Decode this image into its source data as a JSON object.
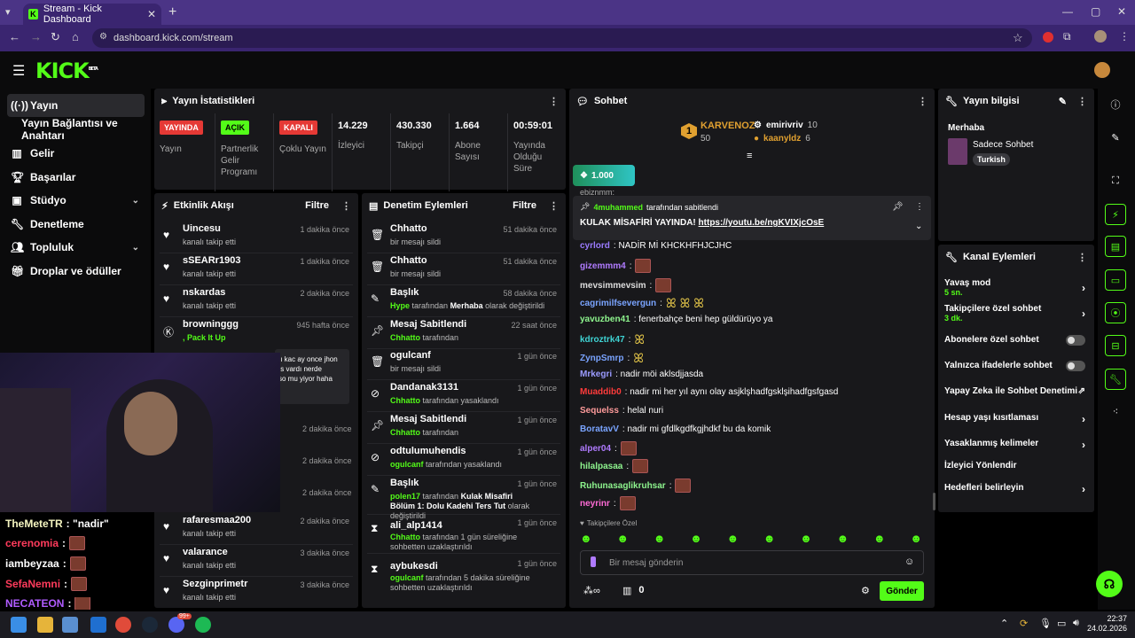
{
  "browser": {
    "tab_title": "Stream - Kick Dashboard",
    "url": "dashboard.kick.com/stream"
  },
  "header": {
    "logo": "KICK",
    "logo_sup": "BETA"
  },
  "sidebar": {
    "items": [
      {
        "label": "Yayın"
      },
      {
        "label": "Yayın Bağlantısı ve Anahtarı"
      },
      {
        "label": "Gelir"
      },
      {
        "label": "Başarılar"
      },
      {
        "label": "Stüdyo"
      },
      {
        "label": "Denetleme"
      },
      {
        "label": "Topluluk"
      },
      {
        "label": "Droplar ve ödüller"
      }
    ]
  },
  "stats": {
    "title": "Yayın İstatistikleri",
    "items": [
      {
        "badge": "YAYINDA",
        "label": "Yayın"
      },
      {
        "badge": "AÇIK",
        "label": "Partnerlik Gelir Programı"
      },
      {
        "badge": "KAPALI",
        "label": "Çoklu Yayın"
      },
      {
        "value": "14.229",
        "label": "İzleyici"
      },
      {
        "value": "430.330",
        "label": "Takipçi"
      },
      {
        "value": "1.664",
        "label": "Abone Sayısı"
      },
      {
        "value": "00:59:01",
        "label": "Yayında Olduğu Süre"
      }
    ]
  },
  "activity": {
    "title": "Etkinlik Akışı",
    "filter": "Filtre",
    "rows": [
      {
        "name": "Uincesu",
        "sub": "kanalı takip etti",
        "time": "1 dakika önce"
      },
      {
        "name": "sSEARr1903",
        "sub": "kanalı takip etti",
        "time": "1 dakika önce"
      },
      {
        "name": "nskardas",
        "sub": "kanalı takip etti",
        "time": "2 dakika önce"
      },
      {
        "name": "browninggg",
        "sub": ", Pack It Up",
        "time": "945 hafta önce"
      },
      {
        "name": "rafaresmaa200",
        "sub": "kanalı takip etti",
        "time": "2 dakika önce"
      },
      {
        "name": "valarance",
        "sub": "kanalı takip etti",
        "time": "3 dakika önce"
      },
      {
        "name": "Sezginprimetr",
        "sub": "kanalı takip etti",
        "time": "3 dakika önce"
      }
    ],
    "hidden_times": [
      "2 dakika önce",
      "2 dakika önce",
      "2 dakika önce"
    ],
    "quote_lines": [
      "ıı kac ay once jhon",
      "ıs vardı nerde",
      "so mu yiyor haha"
    ]
  },
  "moderation": {
    "title": "Denetim Eylemleri",
    "filter": "Filtre",
    "rows": [
      {
        "name": "Chhatto",
        "sub": "bir mesajı sildi",
        "time": "51 dakika önce"
      },
      {
        "name": "Chhatto",
        "sub": "bir mesajı sildi",
        "time": "51 dakika önce"
      },
      {
        "name": "Başlık",
        "sub_a": "Hype",
        "sub_b": " tarafından ",
        "sub_c": "Merhaba",
        "sub_d": " olarak değiştirildi",
        "time": "58 dakika önce"
      },
      {
        "name": "Mesaj Sabitlendi",
        "sub_a": "Chhatto",
        "sub_b": " tarafından",
        "time": "22 saat önce"
      },
      {
        "name": "ogulcanf",
        "sub": "bir mesajı sildi",
        "time": "1 gün önce"
      },
      {
        "name": "Dandanak3131",
        "sub_a": "Chhatto",
        "sub_b": " tarafından yasaklandı",
        "time": "1 gün önce"
      },
      {
        "name": "Mesaj Sabitlendi",
        "sub_a": "Chhatto",
        "sub_b": " tarafından",
        "time": "1 gün önce"
      },
      {
        "name": "odtulumuhendis",
        "sub_a": "ogulcanf",
        "sub_b": " tarafından yasaklandı",
        "time": "1 gün önce"
      },
      {
        "name": "Başlık",
        "sub_a": "polen17",
        "sub_b": " tarafından ",
        "sub_c": "Kulak Misafiri Bölüm 1: Dolu Kadehi Ters Tut",
        "sub_d": " olarak değiştirildi",
        "time": "1 gün önce"
      },
      {
        "name": "ali_alp1414",
        "sub_a": "Chhatto",
        "sub_b": " tarafından 1 gün süreliğine sohbetten uzaklaştırıldı",
        "time": "1 gün önce"
      },
      {
        "name": "aybukesdi",
        "sub_a": "ogulcanf",
        "sub_b": " tarafından 5 dakika süreliğine sohbetten uzaklaştırıldı",
        "time": "1 gün önce"
      }
    ]
  },
  "chat": {
    "title": "Sohbet",
    "top_gifter": {
      "rank": "1",
      "name": "KARVENOZ",
      "amount": "50"
    },
    "gifters": [
      {
        "name": "emirivriv",
        "amount": "10"
      },
      {
        "name": "kaanyldz",
        "amount": "6"
      }
    ],
    "goal": "1.000",
    "pinned_top": "ebiznmm:",
    "pinned_by_user": "4muhammed",
    "pinned_by_text": " tarafından sabitlendi",
    "pinned_msg": "KULAK MİSAFİRİ YAYINDA! ",
    "pinned_link": "https://youtu.be/ngKVIXjcOsE",
    "messages": [
      {
        "user": "cyrlord",
        "color": "#9b7bff",
        "text": ": NADİR Mİ KHCKHFHJCJHC"
      },
      {
        "user": "gizemmm4",
        "color": "#b07bff",
        "text": ":"
      },
      {
        "user": "mevsimmevsim",
        "color": "#ddd",
        "text": ":"
      },
      {
        "user": "cagrimilfsevergun",
        "color": "#7aa4ff",
        "text": ":"
      },
      {
        "user": "yavuzben41",
        "color": "#8ef58e",
        "text": ": fenerbahçe beni hep güldürüyo ya"
      },
      {
        "user": "kdroztrk47",
        "color": "#3fd4d4",
        "text": ":"
      },
      {
        "user": "ZynpSmrp",
        "color": "#7aa4ff",
        "text": ":"
      },
      {
        "user": "Mrkegri",
        "color": "#9b9bff",
        "text": ": nadir möi aklsdjjasda"
      },
      {
        "user": "Muaddib0",
        "color": "#ff3b3b",
        "text": ": nadir mi her yıl aynı olay asjklşhadfgsklşihadfgsfgasd"
      },
      {
        "user": "Sequelss",
        "color": "#ff9b9b",
        "text": ": helal nuri"
      },
      {
        "user": "BoratavV",
        "color": "#7aa4ff",
        "text": ": nadir mi gfdlkgdfkgjhdkf bu da komik"
      },
      {
        "user": "alper04",
        "color": "#b07bff",
        "text": ":"
      },
      {
        "user": "hilalpasaa",
        "color": "#8ef58e",
        "text": ":"
      },
      {
        "user": "Ruhunasaglikruhsar",
        "color": "#8ef58e",
        "text": ":"
      },
      {
        "user": "neyrinr",
        "color": "#ff6bd6",
        "text": ":"
      }
    ],
    "followers_only": "Takipçilere Özel",
    "placeholder": "Bir mesaj gönderin",
    "points": "0",
    "send": "Gönder"
  },
  "stream_info": {
    "title": "Yayın bilgisi",
    "stream_title": "Merhaba",
    "category": "Sadece Sohbet",
    "tag": "Turkish"
  },
  "channel_actions": {
    "title": "Kanal Eylemleri",
    "items": [
      {
        "label": "Yavaş mod",
        "sub": "5 sn."
      },
      {
        "label": "Takipçilere özel sohbet",
        "sub": "3 dk."
      },
      {
        "label": "Abonelere özel sohbet"
      },
      {
        "label": "Yalnızca ifadelerle sohbet"
      },
      {
        "label": "Yapay Zeka ile Sohbet Denetimi"
      },
      {
        "label": "Hesap yaşı kısıtlaması"
      },
      {
        "label": "Yasaklanmış kelimeler"
      },
      {
        "label": "İzleyici Yönlendir"
      },
      {
        "label": "Hedefleri belirleyin"
      }
    ]
  },
  "overlay_chat": [
    {
      "user": "TheMeteTR",
      "color": "#f5f5c0",
      "text": " : \"nadir\""
    },
    {
      "user": "cerenomia",
      "color": "#ff3b5c",
      "text": " :"
    },
    {
      "user": "iambeyzaa",
      "color": "#fff",
      "text": " :"
    },
    {
      "user": "SefaNemni",
      "color": "#ff3b5c",
      "text": " :"
    },
    {
      "user": "NECATEON",
      "color": "#b05cff",
      "text": " :"
    }
  ],
  "taskbar": {
    "time": "22:37",
    "date": "24.02.2026",
    "badge": "99+"
  }
}
